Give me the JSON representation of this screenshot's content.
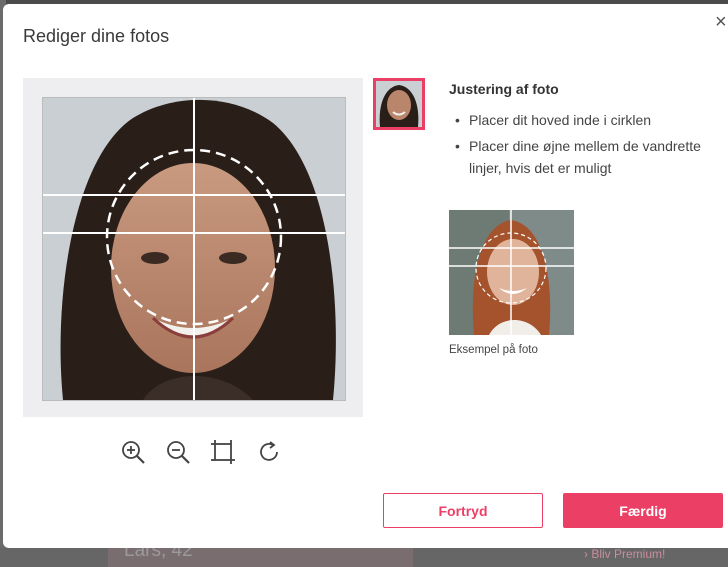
{
  "background": {
    "card_text": "Lars, 42",
    "link_text": "› Bliv Premium!"
  },
  "dialog": {
    "title": "Rediger dine fotos",
    "close_label": "×"
  },
  "editor": {
    "tools": [
      {
        "name": "zoom-in-icon"
      },
      {
        "name": "zoom-out-icon"
      },
      {
        "name": "crop-icon"
      },
      {
        "name": "rotate-icon"
      }
    ]
  },
  "instructions": {
    "title": "Justering af foto",
    "items": [
      "Placer dit hoved inde i cirklen",
      "Placer dine øjne mellem de vandrette linjer, hvis det er muligt"
    ],
    "bullet": "•"
  },
  "example": {
    "caption": "Eksempel på foto"
  },
  "buttons": {
    "cancel": "Fortryd",
    "done": "Færdig"
  },
  "colors": {
    "accent": "#ec3f66"
  }
}
